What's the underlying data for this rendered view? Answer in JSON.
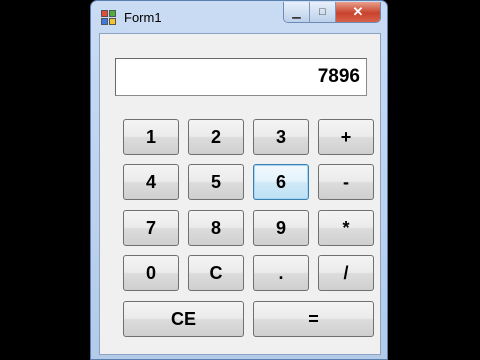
{
  "window": {
    "title": "Form1",
    "controls": {
      "minimize": "▁",
      "maximize": "□",
      "close": "✕"
    }
  },
  "display": {
    "value": "7896"
  },
  "keys": {
    "k1": "1",
    "k2": "2",
    "k3": "3",
    "plus": "+",
    "k4": "4",
    "k5": "5",
    "k6": "6",
    "minus": "-",
    "k7": "7",
    "k8": "8",
    "k9": "9",
    "multiply": "*",
    "k0": "0",
    "clear": "C",
    "dot": ".",
    "divide": "/",
    "clear_entry": "CE",
    "equals": "="
  },
  "colors": {
    "focus_border": "#3c7fb1",
    "title_bar": "#c9dcf3"
  }
}
